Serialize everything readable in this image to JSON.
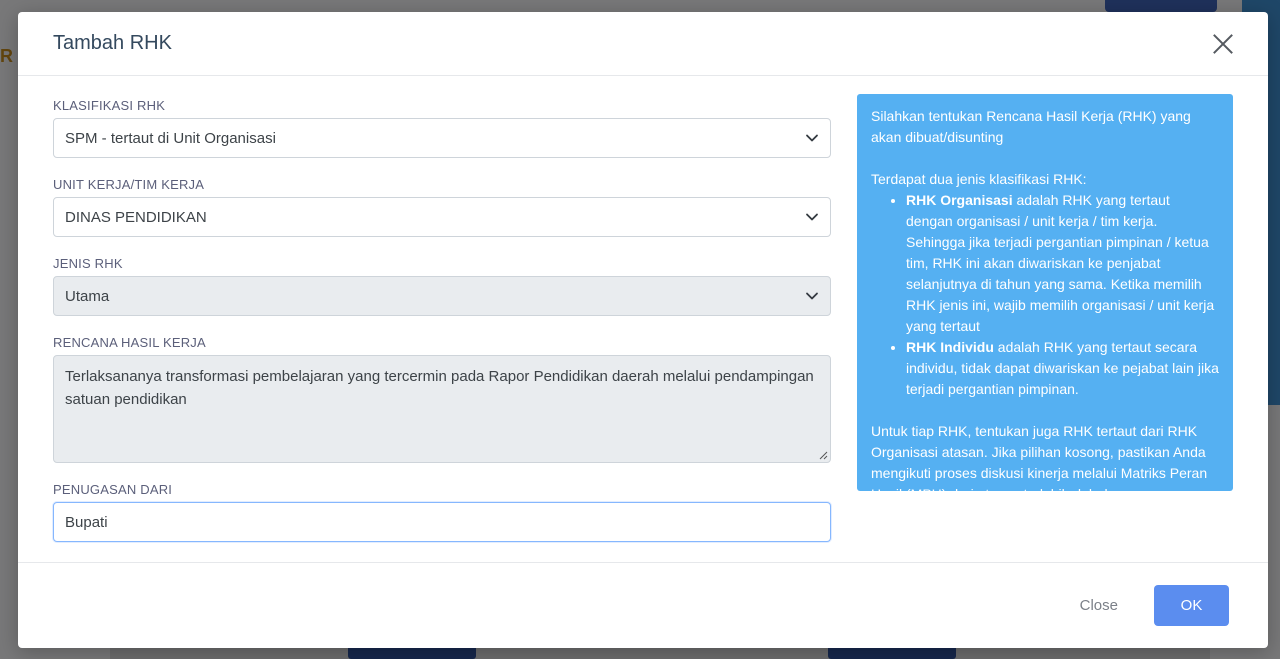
{
  "modal": {
    "title": "Tambah RHK",
    "close_label": "Close",
    "ok_label": "OK"
  },
  "form": {
    "klasifikasi": {
      "label": "KLASIFIKASI RHK",
      "value": "SPM - tertaut di Unit Organisasi"
    },
    "unit_kerja": {
      "label": "UNIT KERJA/TIM KERJA",
      "value": "DINAS PENDIDIKAN"
    },
    "jenis": {
      "label": "JENIS RHK",
      "value": "Utama"
    },
    "rencana": {
      "label": "RENCANA HASIL KERJA",
      "value": "Terlaksananya transformasi pembelajaran yang tercermin pada Rapor Pendidikan daerah melalui pendampingan satuan pendidikan"
    },
    "penugasan": {
      "label": "PENUGASAN DARI",
      "value": "Bupati"
    }
  },
  "info": {
    "intro": "Silahkan tentukan Rencana Hasil Kerja (RHK) yang akan dibuat/disunting",
    "types_intro": "Terdapat dua jenis klasifikasi RHK:",
    "items": [
      {
        "term": "RHK Organisasi",
        "desc": " adalah RHK yang tertaut dengan organisasi / unit kerja / tim kerja. Sehingga jika terjadi pergantian pimpinan / ketua tim, RHK ini akan diwariskan ke penjabat selanjutnya di tahun yang sama. Ketika memilih RHK jenis ini, wajib memilih organisasi / unit kerja yang tertaut"
      },
      {
        "term": "RHK Individu",
        "desc": " adalah RHK yang tertaut secara individu, tidak dapat diwariskan ke pejabat lain jika terjadi pergantian pimpinan."
      }
    ],
    "closing": "Untuk tiap RHK, tentukan juga RHK tertaut dari RHK Organisasi atasan. Jika pilihan kosong, pastikan Anda mengikuti proses diskusi kinerja melalui Matriks Peran Hasil (MPH) dari atasan terlebih dahulu."
  },
  "colors": {
    "info_bg": "#55b0f2",
    "ok_button": "#5b8def",
    "title_text": "#34495e"
  }
}
